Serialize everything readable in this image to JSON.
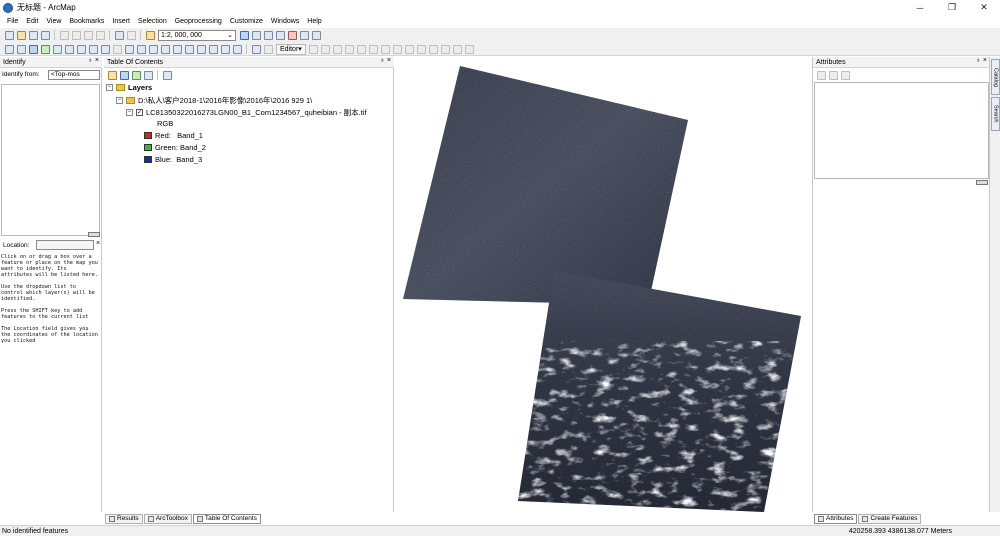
{
  "window": {
    "title": "无标题 - ArcMap",
    "minimize": "─",
    "maximize": "❐",
    "close": "✕"
  },
  "menu": [
    "File",
    "Edit",
    "View",
    "Bookmarks",
    "Insert",
    "Selection",
    "Geoprocessing",
    "Customize",
    "Windows",
    "Help"
  ],
  "toolbar": {
    "scale": "1:2, 000, 000",
    "editor_label": "Editor▾"
  },
  "identify": {
    "title": "Identify",
    "pin": "♁ ×",
    "identify_from_label": "Identify from:",
    "identify_from_value": "<Top-mos",
    "location_label": "Location:",
    "location_value": "",
    "close": "×",
    "help_text": "Click on or drag a box over a\nfeature or place on the map you\nwant to identify. Its\nattributes will be listed here.\n\nUse the dropdown list to\ncontrol which layer(s) will be\nidentified.\n\nPress the SHIFT key to add\nfeatures to the current list\n\nThe Location field gives you\nthe coordinates of the location\nyou clicked"
  },
  "toc": {
    "title": "Table Of Contents",
    "pin": "♁ ×",
    "layers_label": "Layers",
    "folder_path": "D:\\私人\\客户2018-1\\2016年影像\\2016年\\2016 929 1\\",
    "raster_name": "LC81350322016273LGN00_B1_Com1234567_quheibian - 副本.tif",
    "rgb_label": "RGB",
    "bands": [
      {
        "label": "Red:",
        "band": "Band_1",
        "color": "#c62b2b"
      },
      {
        "label": "Green:",
        "band": "Band_2",
        "color": "#3cb83c"
      },
      {
        "label": "Blue:",
        "band": "Band_3",
        "color": "#1c2ba8"
      }
    ]
  },
  "attributes": {
    "title": "Attributes",
    "pin": "♁ ×"
  },
  "side_tabs": [
    "Catalog",
    "Search"
  ],
  "bottom_tabs_left": [
    "Results",
    "ArcToolbox",
    "Table Of Contents"
  ],
  "bottom_tabs_right": [
    "Attributes",
    "Create Features"
  ],
  "status": {
    "message": "No identified features",
    "coordinates": "420258.393  4386138.077 Meters"
  },
  "colors": {
    "scene_dark": "#3c4152",
    "scene_mid": "#565d70",
    "cloud": "#e8ecf2"
  }
}
